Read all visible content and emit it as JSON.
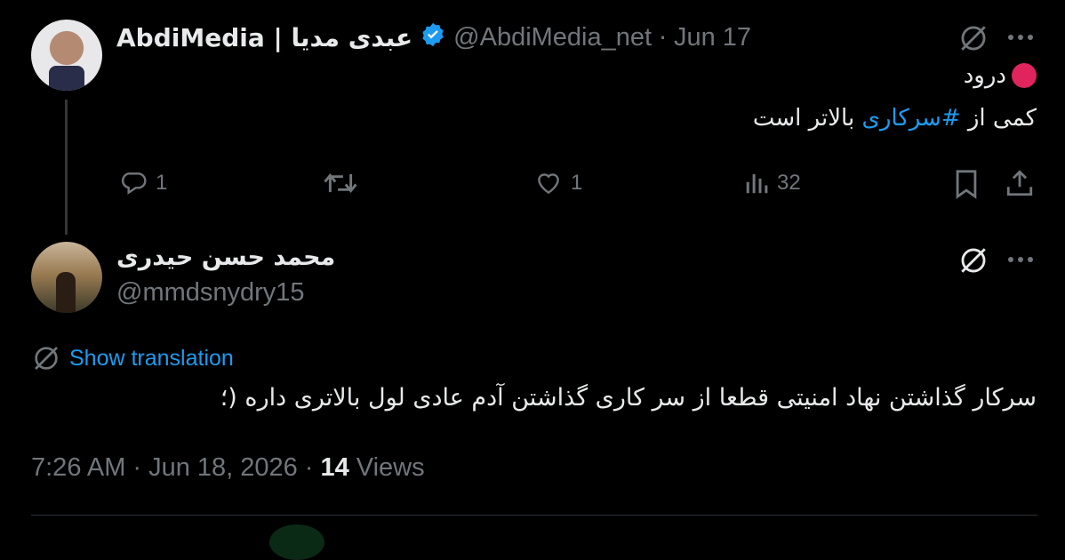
{
  "tweet1": {
    "display_name": "AbdiMedia | عبدی مدیا",
    "handle": "@AbdiMedia_net",
    "separator": "·",
    "date": "Jun 17",
    "line1_emoji_color": "#e0245e",
    "line1_text": "درود",
    "line2_prefix": "کمی از ",
    "line2_hashtag": "#سرکاری",
    "line2_suffix": " بالاتر است",
    "replies": "1",
    "likes": "1",
    "views": "32"
  },
  "tweet2": {
    "display_name": "محمد حسن حیدری",
    "handle": "@mmdsnydry15",
    "show_translation": "Show translation",
    "text": "سرکار گذاشتن نهاد امنیتی قطعا از سر کاری گذاشتن آدم عادی لول بالاتری داره (؛",
    "time": "7:26 AM",
    "date": "Jun 18, 2026",
    "separator": "·",
    "views_count": "14",
    "views_label": "Views"
  },
  "colors": {
    "accent": "#1d9bf0",
    "muted": "#71767b",
    "background": "#000000",
    "text": "#e7e9ea"
  }
}
